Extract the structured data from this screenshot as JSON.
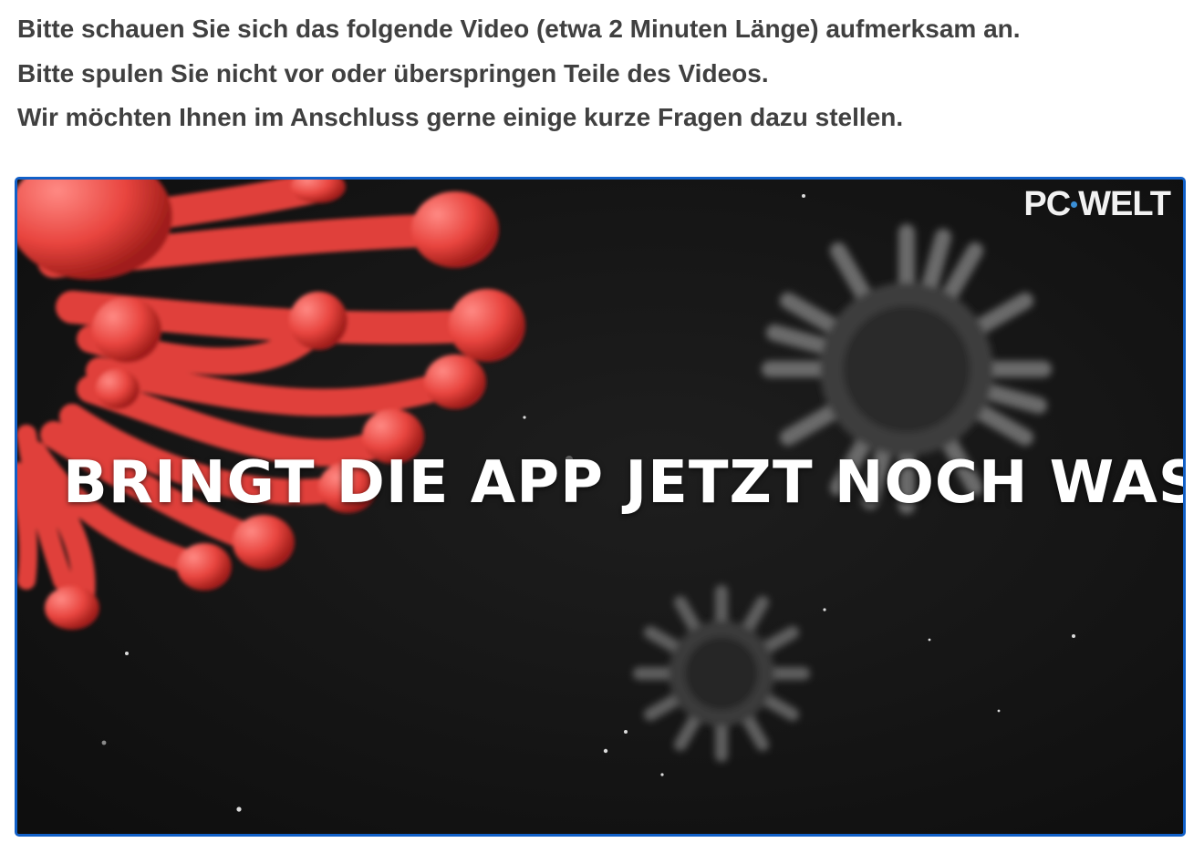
{
  "instructions": {
    "line1": "Bitte schauen Sie sich das folgende Video (etwa 2 Minuten Länge) aufmerksam an.",
    "line2": "Bitte spulen Sie nicht vor oder überspringen Teile des Videos.",
    "line3": "Wir möchten Ihnen im Anschluss gerne einige kurze Fragen dazu stellen."
  },
  "video": {
    "title_text": "BRINGT DIE APP JETZT NOCH WAS?",
    "brand": {
      "part1": "PC",
      "part2": "WELT",
      "dot_color": "#3a8fd6"
    },
    "colors": {
      "border": "#1160c8",
      "background": "#141414",
      "virus_red": "#e8443e"
    }
  }
}
